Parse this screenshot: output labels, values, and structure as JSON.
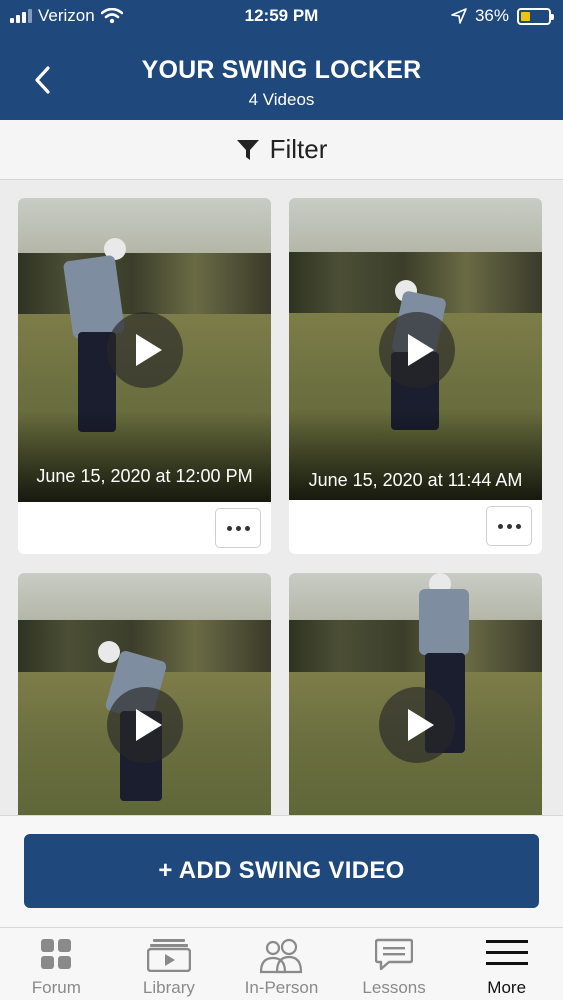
{
  "status_bar": {
    "carrier": "Verizon",
    "time": "12:59 PM",
    "battery": "36%"
  },
  "header": {
    "title": "YOUR SWING LOCKER",
    "subtitle": "4 Videos",
    "back_icon": "chevron-left-icon"
  },
  "filter": {
    "label": "Filter",
    "icon": "funnel-icon"
  },
  "videos": [
    {
      "date": "June 15, 2020 at 12:00 PM"
    },
    {
      "date": "June 15, 2020 at 11:44 AM"
    },
    {
      "date": ""
    },
    {
      "date": ""
    }
  ],
  "add_button": {
    "label": "+ ADD SWING VIDEO"
  },
  "tabs": [
    {
      "label": "Forum",
      "icon": "grid-icon"
    },
    {
      "label": "Library",
      "icon": "video-library-icon"
    },
    {
      "label": "In-Person",
      "icon": "people-icon"
    },
    {
      "label": "Lessons",
      "icon": "chat-bubble-icon"
    },
    {
      "label": "More",
      "icon": "hamburger-menu-icon",
      "active": true
    }
  ],
  "colors": {
    "primary": "#1f487c",
    "battery": "#f1c40f",
    "tab_inactive": "#8a8a8a"
  }
}
